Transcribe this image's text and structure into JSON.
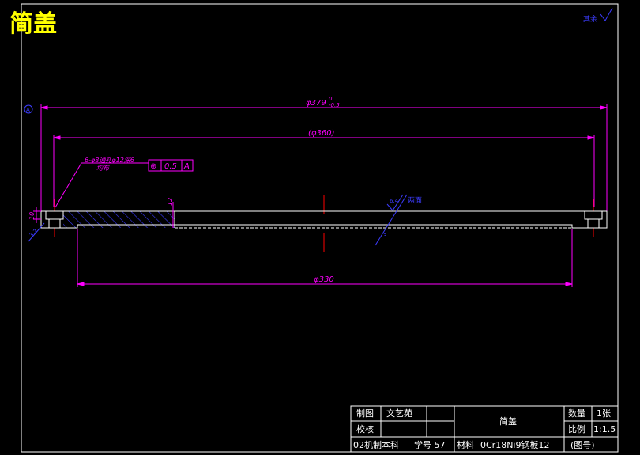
{
  "drawing": {
    "title": "简盖",
    "top_right_note": "其余",
    "colors": {
      "background": "#000000",
      "frame": "#ffffff",
      "dimension": "#ff00ff",
      "annotation": "#3c3cff",
      "centerline": "#ff0000",
      "title": "#ffff00"
    }
  },
  "dimensions": {
    "outer_diameter": "φ379",
    "outer_diameter_tol_upper": "0",
    "outer_diameter_tol_lower": "-0.5",
    "bolt_circle": "(φ360)",
    "inner_diameter": "φ330",
    "thickness": "12",
    "step_height": "10",
    "hole_callout_line1": "6-φ8通孔φ12深6",
    "hole_callout_line2": "均布",
    "position_tol_symbol": "⊕",
    "position_tol_value": "0.5",
    "position_tol_datum": "A",
    "roughness_value": "6.4",
    "roughness_note": "两面",
    "left_roughness": "3.2",
    "datum_label": "A",
    "small_dim": "3"
  },
  "title_block": {
    "draw_label": "制图",
    "drafter": "文艺苑",
    "check_label": "校核",
    "part_name": "简盖",
    "qty_label": "数量",
    "qty_value": "1张",
    "scale_label": "比例",
    "scale_value": "1:1.5",
    "class_info": "02机制本科",
    "student_no": "学号 57",
    "material_label": "材料",
    "material_value": "0Cr18Ni9钢板12",
    "drawing_no": "(图号)"
  }
}
